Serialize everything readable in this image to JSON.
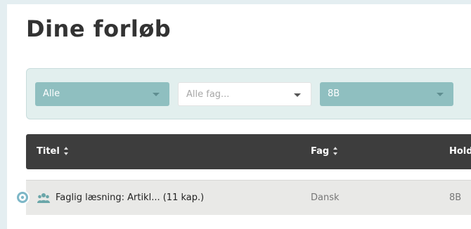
{
  "page": {
    "title": "Dine forløb"
  },
  "filters": {
    "scope": {
      "value": "Alle"
    },
    "subject": {
      "placeholder": "Alle fag..."
    },
    "class": {
      "value": "8B"
    }
  },
  "table": {
    "columns": {
      "title": "Titel",
      "subject": "Fag",
      "class": "Hold"
    },
    "rows": [
      {
        "title": "Faglig læsning: Artikl... (11 kap.)",
        "subject": "Dansk",
        "class": "8B"
      }
    ]
  },
  "colors": {
    "accent_teal": "#8fbfc0",
    "header_dark": "#3d3d3d",
    "row_bg": "#e9e9e7",
    "background": "#e4eef1"
  },
  "icons": [
    "chevron-down-icon",
    "sort-icon",
    "group-icon",
    "badge-icon"
  ]
}
